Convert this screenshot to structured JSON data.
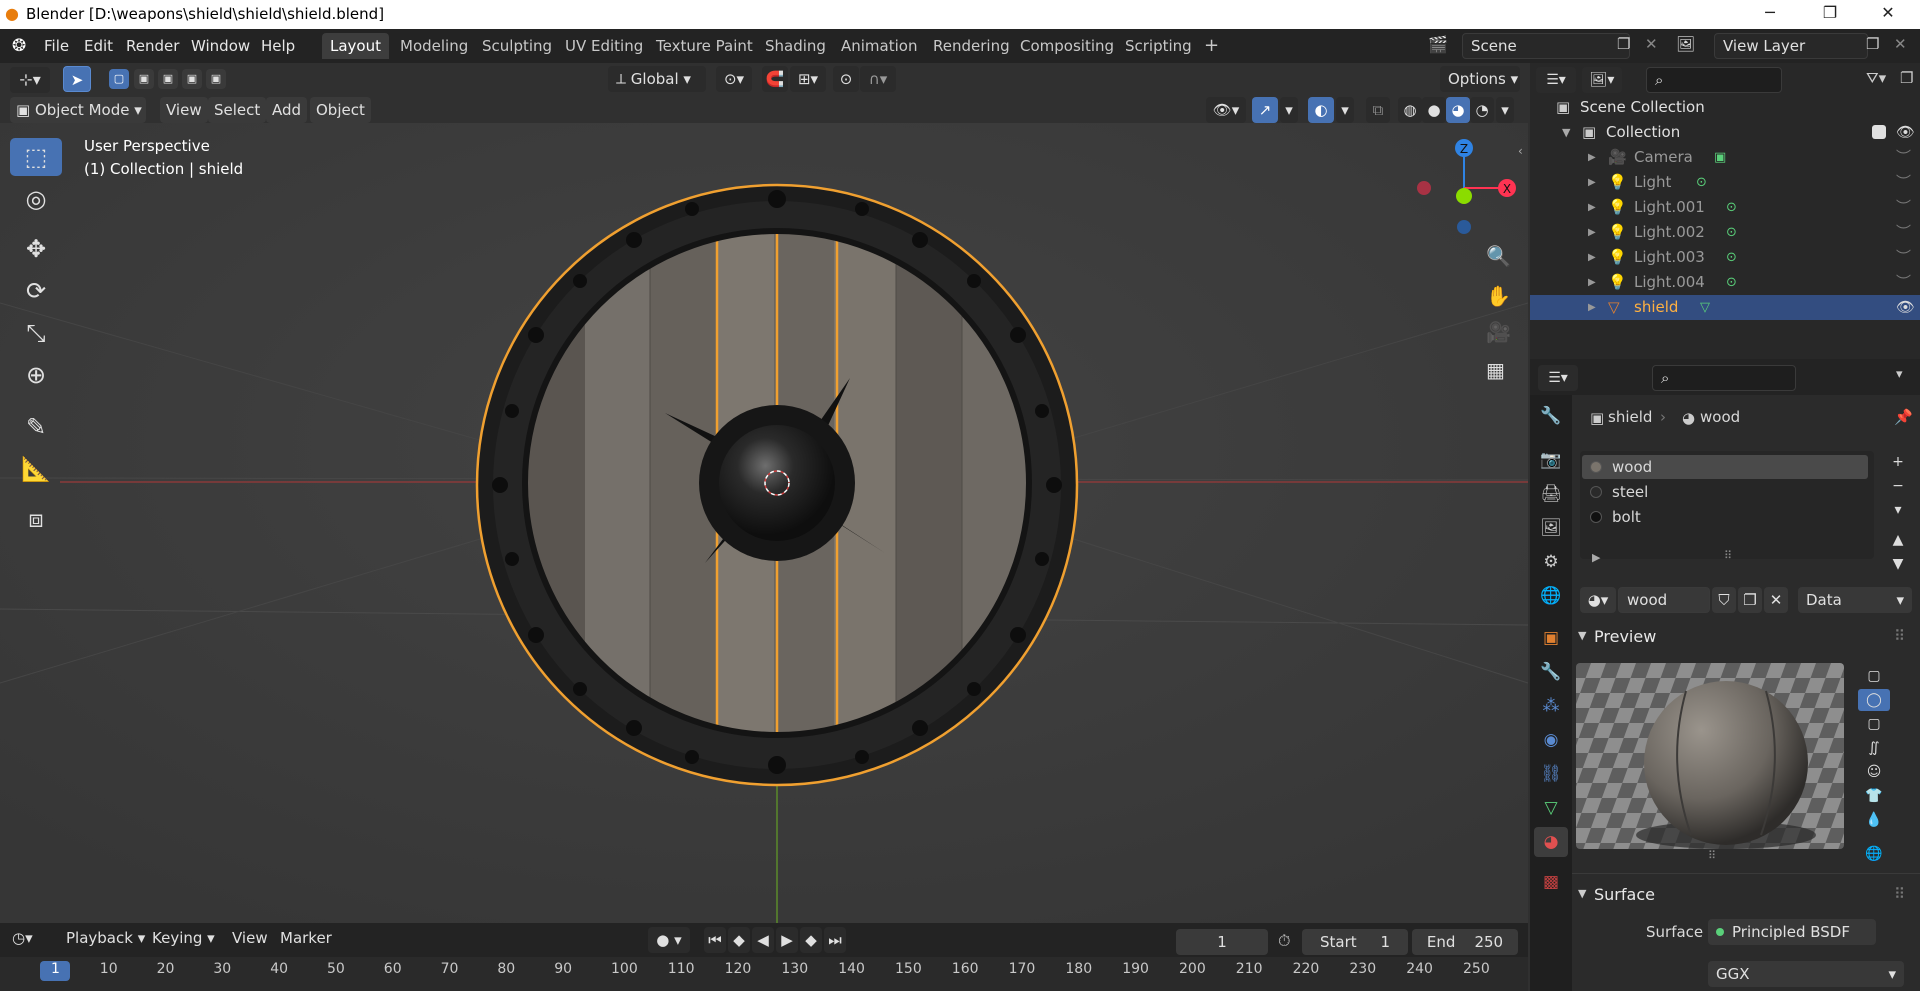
{
  "window": {
    "title": "Blender [D:\\weapons\\shield\\shield\\shield.blend]",
    "minimize": "─",
    "maximize": "❐",
    "close": "✕"
  },
  "menu": [
    "File",
    "Edit",
    "Render",
    "Window",
    "Help"
  ],
  "workspaces": [
    "Layout",
    "Modeling",
    "Sculpting",
    "UV Editing",
    "Texture Paint",
    "Shading",
    "Animation",
    "Rendering",
    "Compositing",
    "Scripting"
  ],
  "active_workspace": "Layout",
  "add_workspace": "+",
  "scene": {
    "name": "Scene",
    "view_layer": "View Layer"
  },
  "viewport": {
    "transform_orientation": "Global",
    "options_label": "Options",
    "mode": "Object Mode",
    "menus": [
      "View",
      "Select",
      "Add",
      "Object"
    ],
    "overlay_title": "User Perspective",
    "overlay_subtitle": "(1) Collection | shield",
    "gizmo_axes": {
      "z": "Z",
      "x": "X"
    }
  },
  "timeline": {
    "menus": [
      "Playback",
      "Keying",
      "View",
      "Marker"
    ],
    "current_frame": "1",
    "start_label": "Start",
    "start_value": "1",
    "end_label": "End",
    "end_value": "250",
    "ticks": [
      "1",
      "10",
      "20",
      "30",
      "40",
      "50",
      "60",
      "70",
      "80",
      "90",
      "100",
      "110",
      "120",
      "130",
      "140",
      "150",
      "160",
      "170",
      "180",
      "190",
      "200",
      "210",
      "220",
      "230",
      "240",
      "250"
    ]
  },
  "outliner": {
    "root": "Scene Collection",
    "collection": "Collection",
    "items": [
      {
        "name": "Camera",
        "type": "camera"
      },
      {
        "name": "Light",
        "type": "light"
      },
      {
        "name": "Light.001",
        "type": "light"
      },
      {
        "name": "Light.002",
        "type": "light"
      },
      {
        "name": "Light.003",
        "type": "light"
      },
      {
        "name": "Light.004",
        "type": "light"
      },
      {
        "name": "shield",
        "type": "mesh",
        "selected": true
      }
    ]
  },
  "properties": {
    "breadcrumb_object": "shield",
    "breadcrumb_material": "wood",
    "material_slots": [
      "wood",
      "steel",
      "bolt"
    ],
    "active_slot": "wood",
    "material_name": "wood",
    "link": "Data",
    "preview_header": "Preview",
    "surface_header": "Surface",
    "surface_label": "Surface",
    "surface_value": "Principled BSDF",
    "distribution": "GGX"
  },
  "colors": {
    "accent_blue": "#4772b3",
    "selection_orange": "#f0a030",
    "axis_red": "#ff3352",
    "axis_green": "#8bdc00",
    "axis_blue": "#2f83e3"
  }
}
